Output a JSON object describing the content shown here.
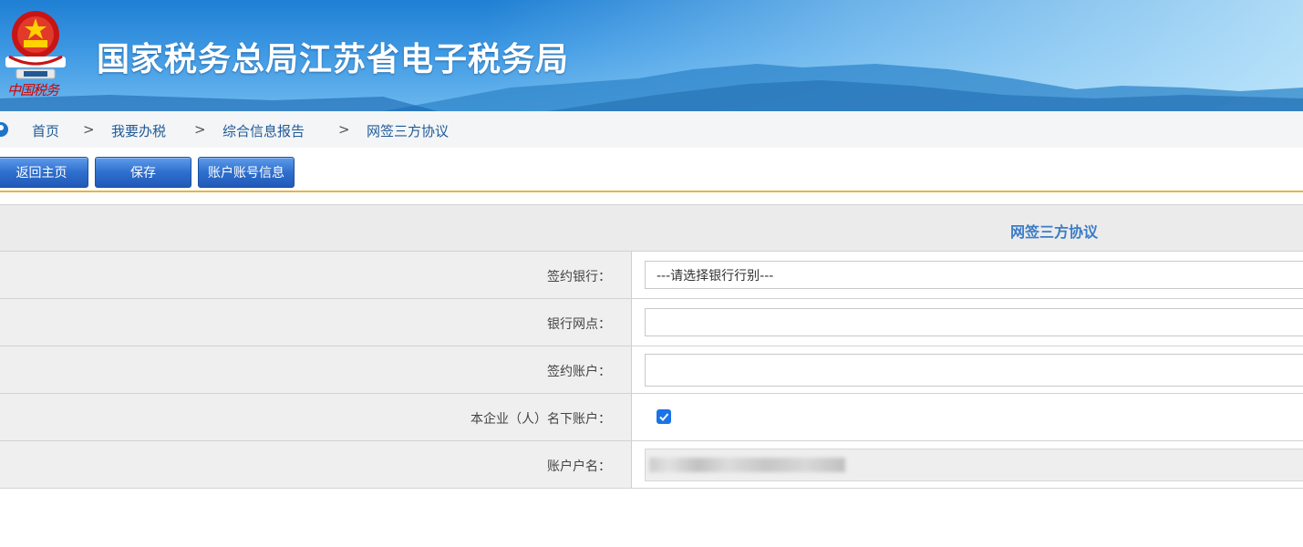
{
  "header": {
    "emblem_icon": "tax-emblem-icon",
    "emblem_subtext": "中国税务",
    "title": "国家税务总局江苏省电子税务局",
    "colors": {
      "banner": "#2d8ad9",
      "title": "#ffffff",
      "emblem_red": "#d40000"
    }
  },
  "breadcrumb": {
    "icon": "home-location-icon",
    "items": [
      "首页",
      "我要办税",
      "综合信息报告",
      "网签三方协议"
    ],
    "separator": ">"
  },
  "toolbar": {
    "buttons": [
      "返回主页",
      "保存",
      "账户账号信息"
    ],
    "accent_line_color": "#e3b44b"
  },
  "form": {
    "title": "网签三方协议",
    "rows": [
      {
        "label": "签约银行：",
        "type": "select",
        "value": "---请选择银行行别---"
      },
      {
        "label": "银行网点：",
        "type": "input",
        "value": ""
      },
      {
        "label": "签约账户：",
        "type": "input",
        "value": ""
      },
      {
        "label": "本企业（人）名下账户：",
        "type": "checkbox",
        "checked": true
      },
      {
        "label": "账户户名：",
        "type": "readonly",
        "value": ""
      }
    ]
  }
}
